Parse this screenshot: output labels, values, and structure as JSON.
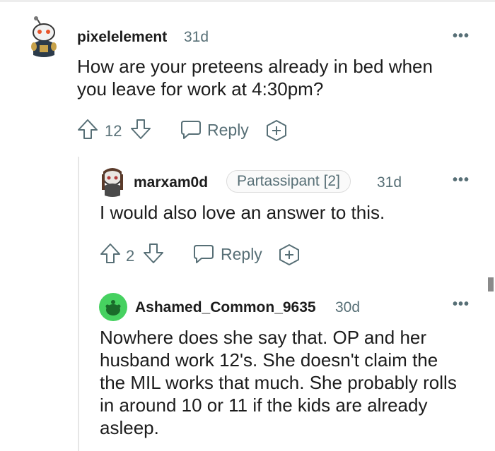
{
  "comments": [
    {
      "username": "pixelelement",
      "age": "31d",
      "body": "How are your preteens already in bed when you leave for work at 4:30pm?",
      "votes": "12",
      "reply_label": "Reply",
      "more_label": "•••"
    },
    {
      "username": "marxam0d",
      "flair": "Partassipant [2]",
      "age": "31d",
      "body": "I would also love an answer to this.",
      "votes": "2",
      "reply_label": "Reply",
      "more_label": "•••"
    },
    {
      "username": "Ashamed_Common_9635",
      "age": "30d",
      "body": "Nowhere does she say that. OP and her husband work 12's. She doesn't claim the the MIL works that much. She probably rolls in around 10 or 11 if the kids are already asleep.",
      "more_label": "•••"
    }
  ],
  "colors": {
    "text": "#1c1c1c",
    "meta": "#576f76",
    "avatar_green": "#46d160"
  },
  "icons": [
    "upvote-icon",
    "downvote-icon",
    "reply-bubble-icon",
    "award-plus-icon",
    "more-options-icon"
  ]
}
